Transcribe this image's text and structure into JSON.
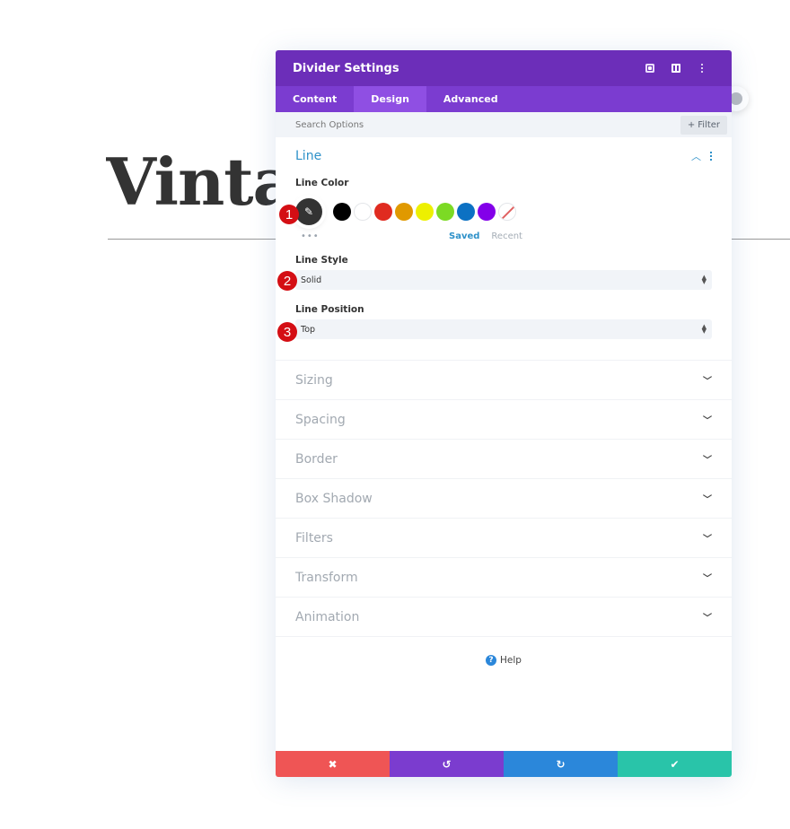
{
  "background": {
    "heading": "Vintag"
  },
  "modal": {
    "title": "Divider Settings",
    "header_icons": [
      "expand-icon",
      "columns-icon",
      "more-vertical-icon"
    ],
    "tabs": [
      {
        "label": "Content",
        "active": false
      },
      {
        "label": "Design",
        "active": true
      },
      {
        "label": "Advanced",
        "active": false
      }
    ],
    "search": {
      "placeholder": "Search Options",
      "value": ""
    },
    "filter_label": "Filter",
    "filter_icon": "+",
    "line_section": {
      "title": "Line",
      "line_color_label": "Line Color",
      "picker_icon": "✎",
      "swatches": [
        "#000000",
        "#ffffff",
        "#e02b20",
        "#e09900",
        "#edf000",
        "#7cda24",
        "#0c71c3",
        "#8300e9",
        "none"
      ],
      "more_label": "•••",
      "saved_label": "Saved",
      "recent_label": "Recent",
      "line_style_label": "Line Style",
      "line_style_value": "Solid",
      "line_position_label": "Line Position",
      "line_position_value": "Top"
    },
    "sections": [
      "Sizing",
      "Spacing",
      "Border",
      "Box Shadow",
      "Filters",
      "Transform",
      "Animation"
    ],
    "help_label": "Help",
    "footer": {
      "cancel_icon": "✖",
      "undo_icon": "↺",
      "redo_icon": "↻",
      "save_icon": "✔"
    },
    "accent_color": "#2e91c9",
    "header_color": "#6c2eb9"
  },
  "callouts": [
    "1",
    "2",
    "3"
  ]
}
